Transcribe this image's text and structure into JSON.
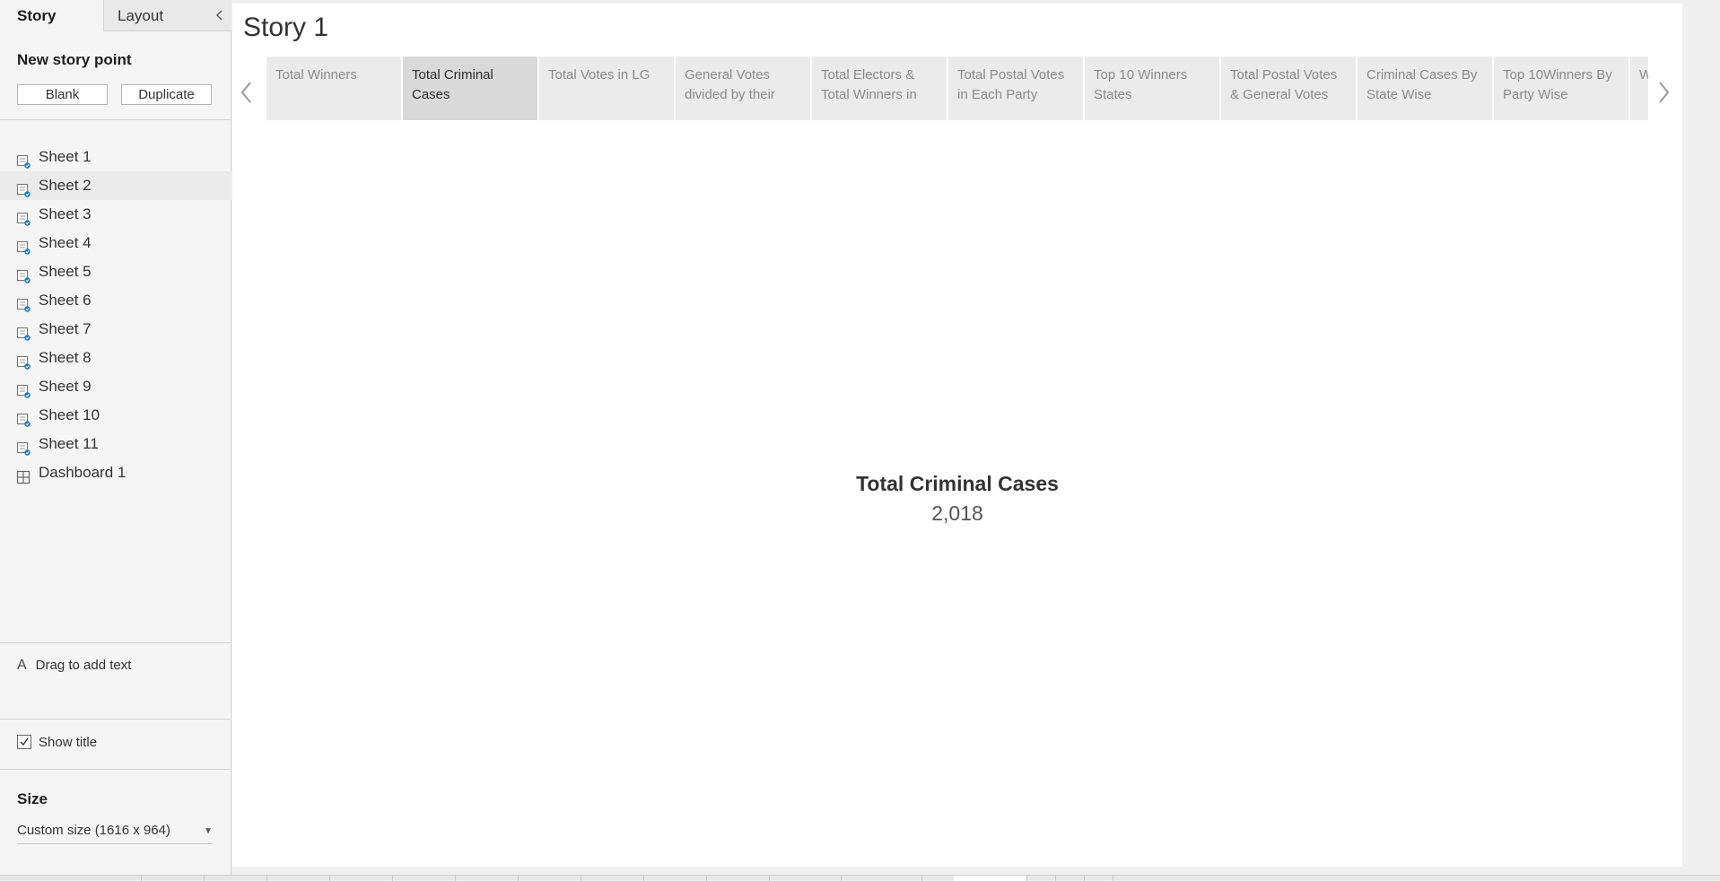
{
  "panel": {
    "tabs": [
      "Story",
      "Layout"
    ],
    "new_story_point": {
      "heading": "New story point",
      "blank": "Blank",
      "duplicate": "Duplicate"
    },
    "sheets": [
      {
        "label": "Sheet 1",
        "icon": "worksheet-icon"
      },
      {
        "label": "Sheet 2",
        "icon": "worksheet-icon"
      },
      {
        "label": "Sheet 3",
        "icon": "worksheet-icon"
      },
      {
        "label": "Sheet 4",
        "icon": "worksheet-icon"
      },
      {
        "label": "Sheet 5",
        "icon": "worksheet-icon"
      },
      {
        "label": "Sheet 6",
        "icon": "worksheet-icon"
      },
      {
        "label": "Sheet 7",
        "icon": "worksheet-icon"
      },
      {
        "label": "Sheet 8",
        "icon": "worksheet-icon"
      },
      {
        "label": "Sheet 9",
        "icon": "worksheet-icon"
      },
      {
        "label": "Sheet 10",
        "icon": "worksheet-icon"
      },
      {
        "label": "Sheet 11",
        "icon": "worksheet-icon"
      },
      {
        "label": "Dashboard 1",
        "icon": "dashboard-icon"
      }
    ],
    "drag_text": {
      "glyph": "A",
      "label": "Drag to add text"
    },
    "show_title": {
      "label": "Show title",
      "checked": true
    },
    "size": {
      "heading": "Size",
      "value": "Custom size (1616 x 964)"
    }
  },
  "story": {
    "title": "Story 1",
    "points": [
      {
        "label": "Total Winners",
        "active": false
      },
      {
        "label": "Total Criminal Cases",
        "active": true
      },
      {
        "label": "Total Votes in LG",
        "active": false
      },
      {
        "label": "General Votes divided by their",
        "active": false
      },
      {
        "label": "Total Electors & Total Winners in",
        "active": false
      },
      {
        "label": "Total Postal Votes in Each Party",
        "active": false
      },
      {
        "label": "Top 10 Winners States",
        "active": false
      },
      {
        "label": "Total Postal Votes & General Votes",
        "active": false
      },
      {
        "label": "Criminal Cases By State Wise",
        "active": false
      },
      {
        "label": "Top 10Winners By Party Wise",
        "active": false
      },
      {
        "label": "W C",
        "active": false
      }
    ],
    "kpi": {
      "label": "Total Criminal Cases",
      "value": "2,018"
    }
  },
  "colors": {
    "accent": "#1f77b4",
    "panel_bg": "#f5f5f5",
    "point_bg": "#ebebeb",
    "point_active_bg": "#d9d9d9"
  }
}
